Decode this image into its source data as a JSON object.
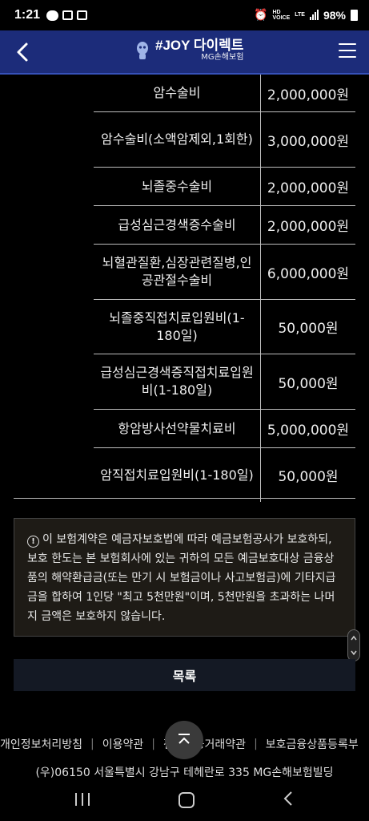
{
  "status": {
    "time": "1:21",
    "battery": "98%",
    "hd": "HD",
    "lte": "LTE",
    "voice": "VOICE"
  },
  "app": {
    "title": "#JOY 다이렉트",
    "subtitle": "MG손해보험"
  },
  "table_rows": [
    {
      "name": "암수술비",
      "amount": "2,000,000원"
    },
    {
      "name": "암수술비(소액암제외,1회한)",
      "amount": "3,000,000원"
    },
    {
      "name": "뇌졸중수술비",
      "amount": "2,000,000원"
    },
    {
      "name": "급성심근경색증수술비",
      "amount": "2,000,000원"
    },
    {
      "name": "뇌혈관질환,심장관련질병,인공관절수술비",
      "amount": "6,000,000원"
    },
    {
      "name": "뇌졸중직접치료입원비(1-180일)",
      "amount": "50,000원"
    },
    {
      "name": "급성심근경색증직접치료입원비(1-180일)",
      "amount": "50,000원"
    },
    {
      "name": "항암방사선약물치료비",
      "amount": "5,000,000원"
    },
    {
      "name": "암직접치료입원비(1-180일)",
      "amount": "50,000원"
    }
  ],
  "notice": {
    "icon": "!",
    "text": "이 보험계약은 예금자보호법에 따라 예금보험공사가 보호하되, 보호 한도는 본 보험회사에 있는 귀하의 모든 예금보호대상 금융상품의 해약환급금(또는 만기 시 보험금이나 사고보험금)에 기타지급금을 합하여 1인당 \"최고 5천만원\"이며, 5천만원을 초과하는 나머지 금액은 보호하지 않습니다."
  },
  "list_button": "목록",
  "footer": {
    "links": [
      "개인정보처리방침",
      "이용약관",
      "전자금융거래약관",
      "보호금융상품등록부"
    ],
    "address": "(우)06150 서울특별시 강남구 테헤란로 335 MG손해보험빌딩"
  },
  "colors": {
    "appbar": "#1c2c7a",
    "accent": "#3651b8",
    "background": "#000000"
  }
}
